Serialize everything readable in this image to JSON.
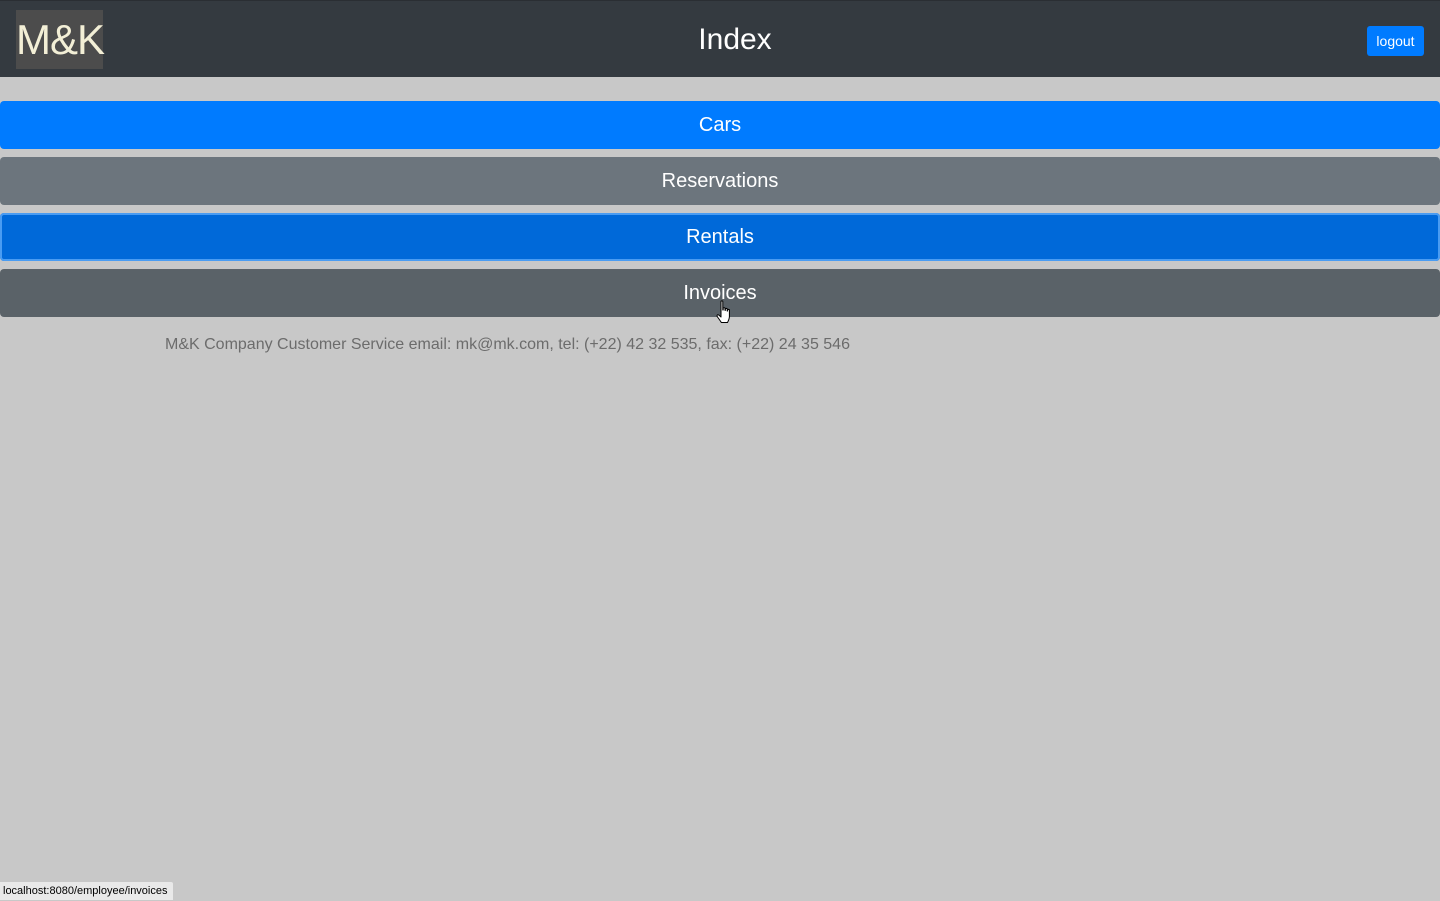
{
  "header": {
    "logo_text": "M&K",
    "title": "Index",
    "logout_label": "logout"
  },
  "nav": {
    "items": [
      {
        "label": "Cars",
        "style": "primary"
      },
      {
        "label": "Reservations",
        "style": "secondary"
      },
      {
        "label": "Rentals",
        "style": "primary-focused"
      },
      {
        "label": "Invoices",
        "style": "secondary-hovered"
      }
    ]
  },
  "footer": {
    "text": "M&K Company Customer Service email: mk@mk.com, tel: (+22) 42 32 535, fax: (+22) 24 35 546"
  },
  "status_bar": {
    "url": "localhost:8080/employee/invoices"
  },
  "colors": {
    "header_bg": "#343a40",
    "page_bg": "#c8c8c8",
    "primary": "#007bff",
    "secondary": "#6c757d"
  },
  "icons": {
    "cursor": "hand-pointer-icon"
  }
}
